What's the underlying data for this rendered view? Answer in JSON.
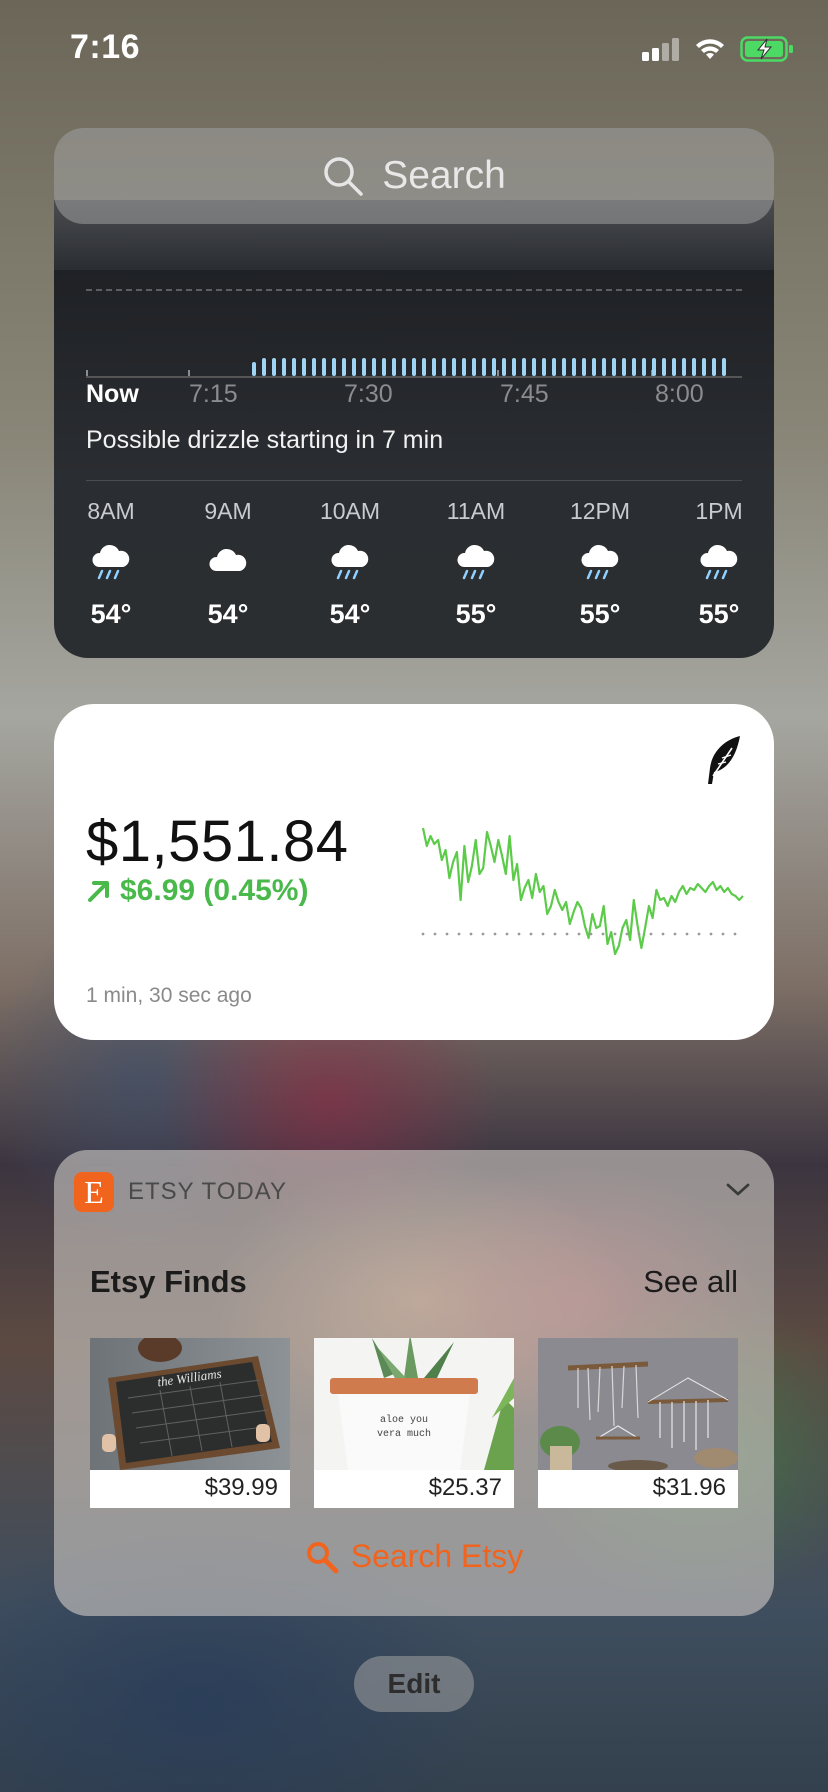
{
  "status_bar": {
    "time": "7:16"
  },
  "search": {
    "placeholder": "Search"
  },
  "weather": {
    "timeline_labels": [
      "Now",
      "7:15",
      "7:30",
      "7:45",
      "8:00"
    ],
    "summary": "Possible drizzle starting in 7 min",
    "hourly": [
      {
        "time": "8AM",
        "icon": "rain-cloud-icon",
        "temp": "54°"
      },
      {
        "time": "9AM",
        "icon": "cloud-icon",
        "temp": "54°"
      },
      {
        "time": "10AM",
        "icon": "rain-cloud-icon",
        "temp": "54°"
      },
      {
        "time": "11AM",
        "icon": "rain-cloud-icon",
        "temp": "55°"
      },
      {
        "time": "12PM",
        "icon": "rain-cloud-icon",
        "temp": "55°"
      },
      {
        "time": "1PM",
        "icon": "rain-cloud-icon",
        "temp": "55°"
      }
    ]
  },
  "stock": {
    "value": "$1,551.84",
    "change": "$6.99 (0.45%)",
    "updated": "1 min, 30 sec ago",
    "app_icon": "feather-icon",
    "line_color": "#5ccb4a"
  },
  "etsy": {
    "app_name": "ETSY TODAY",
    "section_title": "Etsy Finds",
    "see_all": "See all",
    "items": [
      {
        "price": "$39.99",
        "image_text": "the Williams"
      },
      {
        "price": "$25.37",
        "image_text": "aloe you vera much"
      },
      {
        "price": "$31.96"
      }
    ],
    "search_label": "Search Etsy",
    "brand_color": "#f1641e"
  },
  "edit_button": {
    "label": "Edit"
  }
}
